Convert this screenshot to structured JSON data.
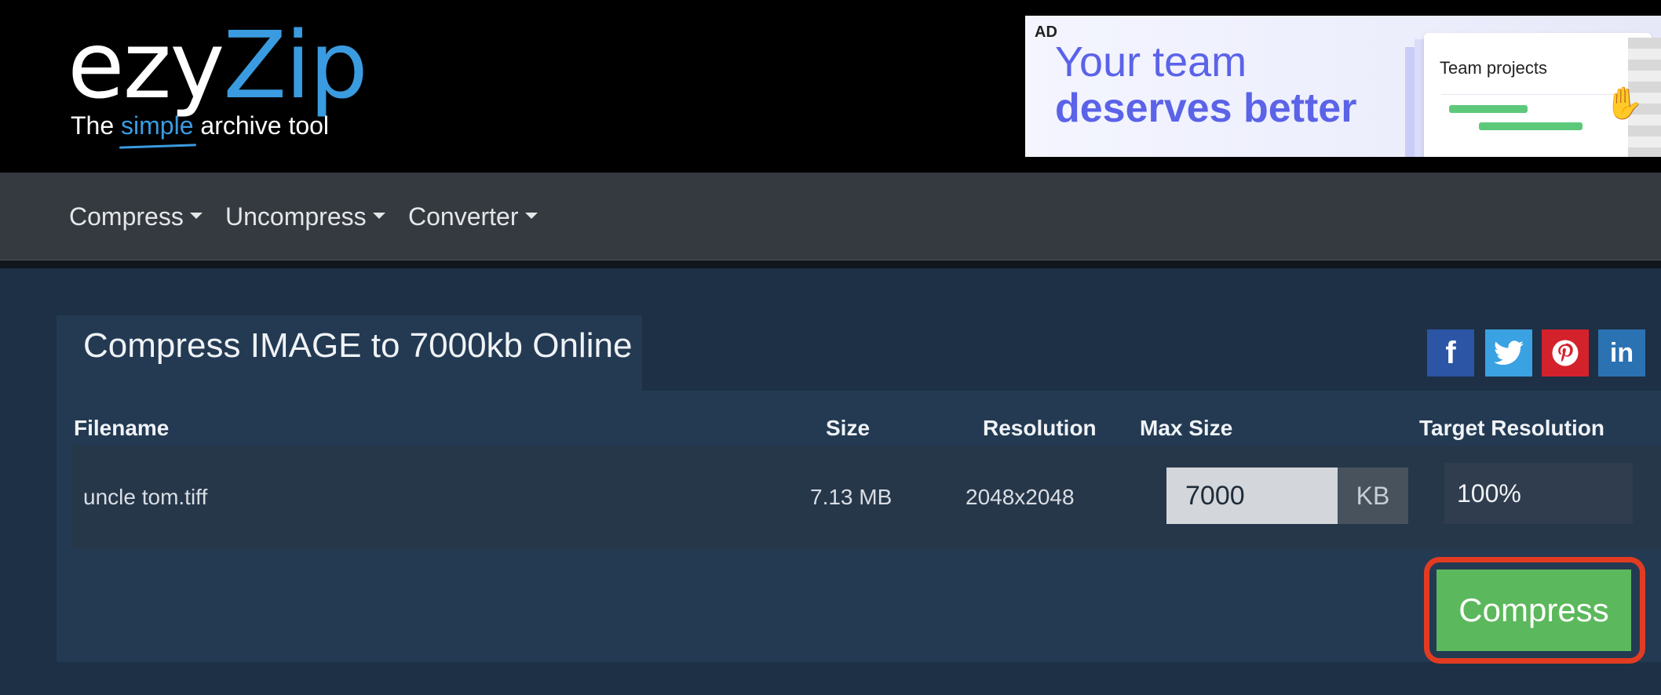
{
  "logo": {
    "ezy": "ezy",
    "zip": "Zip",
    "tag_the": "The",
    "tag_simple": "simple",
    "tag_rest": "archive tool"
  },
  "ad": {
    "tag": "AD",
    "line1": "Your team",
    "line2": "deserves better",
    "card_title": "Team projects"
  },
  "nav": {
    "items": [
      {
        "label": "Compress"
      },
      {
        "label": "Uncompress"
      },
      {
        "label": "Converter"
      }
    ]
  },
  "tab": {
    "title": "Compress IMAGE to 7000kb Online"
  },
  "share": {
    "facebook": "f",
    "linkedin": "in"
  },
  "table": {
    "headers": {
      "filename": "Filename",
      "size": "Size",
      "resolution": "Resolution",
      "max_size": "Max Size",
      "target_resolution": "Target Resolution"
    },
    "rows": [
      {
        "filename": "uncle tom.tiff",
        "size": "7.13 MB",
        "resolution": "2048x2048",
        "max_size": "7000",
        "max_unit": "KB",
        "target_resolution": "100%"
      }
    ]
  },
  "actions": {
    "compress_label": "Compress"
  },
  "colors": {
    "accent": "#3a9be0",
    "compress": "#5cb85c",
    "highlight": "#e23b22",
    "nav_bg": "#343a40",
    "main_bg": "#1d3045"
  }
}
